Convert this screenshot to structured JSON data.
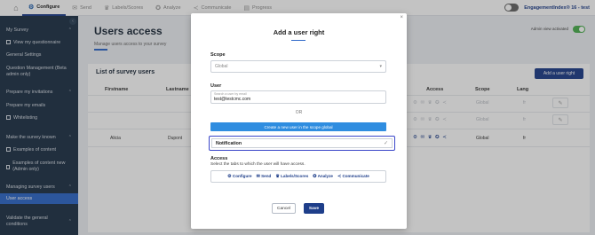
{
  "topnav": {
    "home_icon": "home-icon",
    "tabs": [
      {
        "label": "Configure",
        "icon": "gear-icon",
        "active": true
      },
      {
        "label": "Send",
        "icon": "envelope-icon",
        "active": false
      },
      {
        "label": "Labels/Scores",
        "icon": "trophy-icon",
        "active": false
      },
      {
        "label": "Analyze",
        "icon": "brain-icon",
        "active": false
      },
      {
        "label": "Communicate",
        "icon": "share-icon",
        "active": false
      },
      {
        "label": "Progress",
        "icon": "chart-icon",
        "active": false
      }
    ],
    "brand": "EngagementIndex® 16 - test"
  },
  "sidebar": {
    "items": [
      {
        "label": "My Survey"
      },
      {
        "label": "View my questionnaire"
      },
      {
        "label": "General Settings"
      },
      {
        "label": "Question Management (Beta admin only)"
      },
      {
        "label": "Prepare my invitations"
      },
      {
        "label": "Prepare my emails"
      },
      {
        "label": "Whitelisting"
      },
      {
        "label": "Make the survey known"
      },
      {
        "label": "Examples of content"
      },
      {
        "label": "Examples of content new (Admin only)"
      },
      {
        "label": "Managing survey users"
      },
      {
        "label": "User access"
      },
      {
        "label": "Validate the general conditions"
      }
    ]
  },
  "page": {
    "title": "Users access",
    "subtitle": "Manage users access to your survey",
    "admin_view": "Admin view activated"
  },
  "users_card": {
    "title": "List of survey users",
    "add_button": "Add a user right",
    "columns": [
      "Firstname",
      "Lastname",
      "Access",
      "Scope",
      "Lang"
    ],
    "rows": [
      {
        "firstname": "",
        "lastname": "",
        "scope": "Global",
        "lang": "fr"
      },
      {
        "firstname": "",
        "lastname": "",
        "scope": "Global",
        "lang": "fr"
      },
      {
        "firstname": "Alicia",
        "lastname": "Dupont",
        "scope": "Global",
        "lang": "fr"
      }
    ]
  },
  "modal": {
    "title": "Add a user right",
    "scope_label": "Scope",
    "scope_value": "Global",
    "user_label": "User",
    "user_placeholder": "Search a user by email",
    "user_value": "test@testcmc.com",
    "or_text": "OR",
    "create_button": "Create a new user in the scope global",
    "notification_label": "Notification",
    "access_label": "Access",
    "access_desc": "Select the tabs to which the user will have access.",
    "access_tabs": [
      {
        "label": "Configure",
        "icon": "gear-icon"
      },
      {
        "label": "Send",
        "icon": "envelope-icon"
      },
      {
        "label": "Labels/Scores",
        "icon": "trophy-icon"
      },
      {
        "label": "Analyze",
        "icon": "brain-icon"
      },
      {
        "label": "Communicate",
        "icon": "share-icon"
      }
    ],
    "cancel_button": "Cancel",
    "save_button": "Save"
  },
  "colors": {
    "navy": "#1e3e8a",
    "sidebar_bg": "#1f3247",
    "active_blue": "#2f68c9",
    "create_btn": "#2f8de0",
    "toggle_green": "#4caf50"
  }
}
